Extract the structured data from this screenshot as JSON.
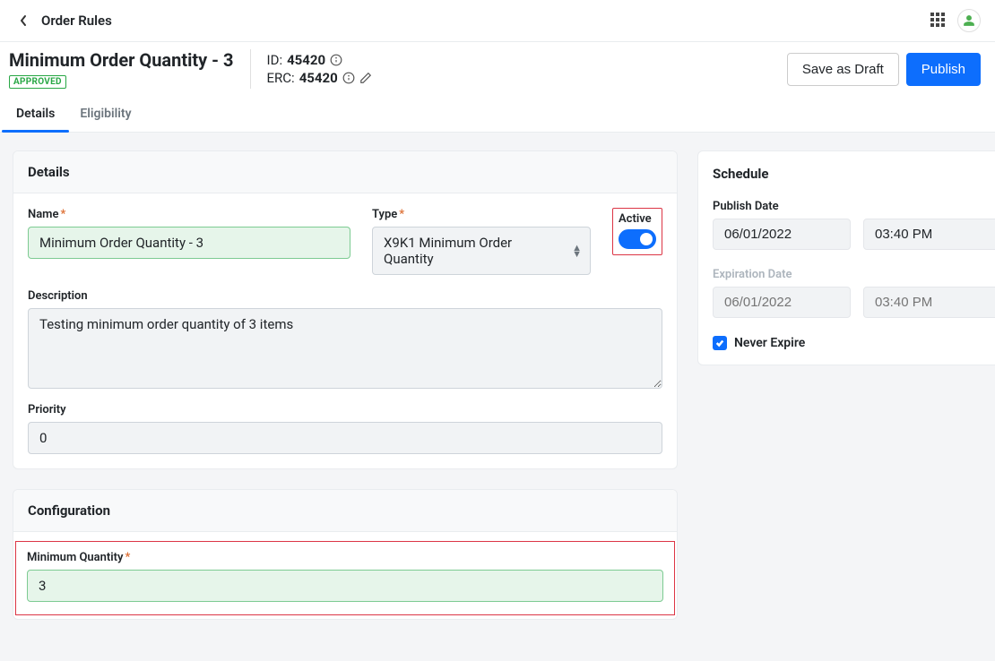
{
  "topbar": {
    "title": "Order Rules"
  },
  "header": {
    "page_title": "Minimum Order Quantity - 3",
    "status": "APPROVED",
    "id_label": "ID:",
    "id_value": "45420",
    "erc_label": "ERC:",
    "erc_value": "45420",
    "save_draft_label": "Save as Draft",
    "publish_label": "Publish"
  },
  "tabs": {
    "details": "Details",
    "eligibility": "Eligibility"
  },
  "details": {
    "card_title": "Details",
    "name_label": "Name",
    "name_value": "Minimum Order Quantity - 3",
    "type_label": "Type",
    "type_value": "X9K1 Minimum Order Quantity",
    "active_label": "Active",
    "description_label": "Description",
    "description_value": "Testing minimum order quantity of 3 items",
    "priority_label": "Priority",
    "priority_value": "0"
  },
  "schedule": {
    "card_title": "Schedule",
    "publish_label": "Publish Date",
    "publish_date": "06/01/2022",
    "publish_time": "03:40 PM",
    "expiration_label": "Expiration Date",
    "expiration_date_placeholder": "06/01/2022",
    "expiration_time_placeholder": "03:40 PM",
    "never_expire_label": "Never Expire"
  },
  "configuration": {
    "card_title": "Configuration",
    "min_qty_label": "Minimum Quantity",
    "min_qty_value": "3"
  }
}
